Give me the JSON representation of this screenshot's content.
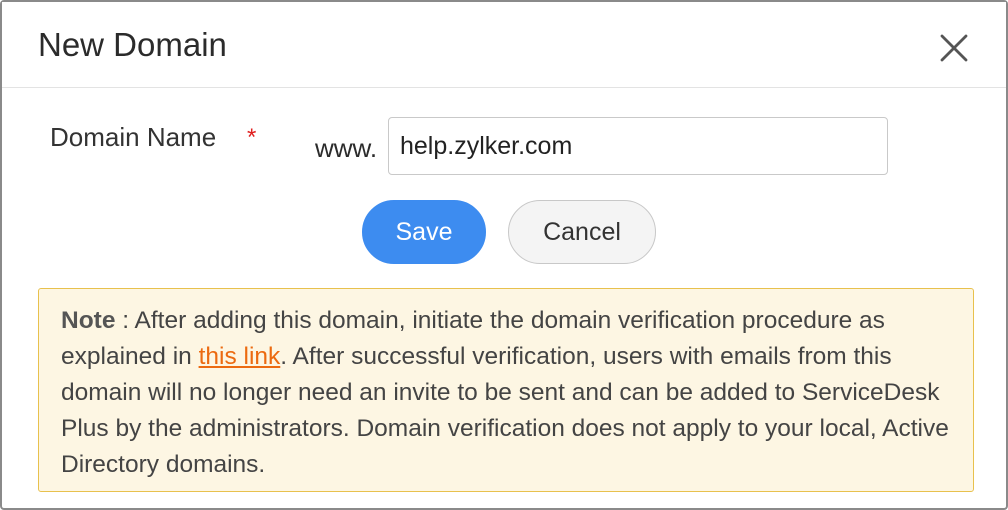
{
  "dialog": {
    "title": "New Domain",
    "close_icon": "close-icon"
  },
  "form": {
    "domain_label": "Domain Name",
    "required_marker": "*",
    "prefix": "www.",
    "domain_value": "help.zylker.com"
  },
  "actions": {
    "save_label": "Save",
    "cancel_label": "Cancel"
  },
  "note": {
    "heading": "Note",
    "separator": " : ",
    "text_before_link": "After adding this domain, initiate the domain verification procedure as explained in ",
    "link_text": "this link",
    "text_after_link": ". After successful verification, users with emails from this domain will no longer need an invite to be sent and can be added to ServiceDesk Plus by the administrators. Domain verification does not apply to your local, Active Directory domains."
  },
  "colors": {
    "primary": "#3d8cf0",
    "required": "#e02020",
    "link": "#ec6a10",
    "note_bg": "#fdf6e3",
    "note_border": "#e8c14d"
  }
}
